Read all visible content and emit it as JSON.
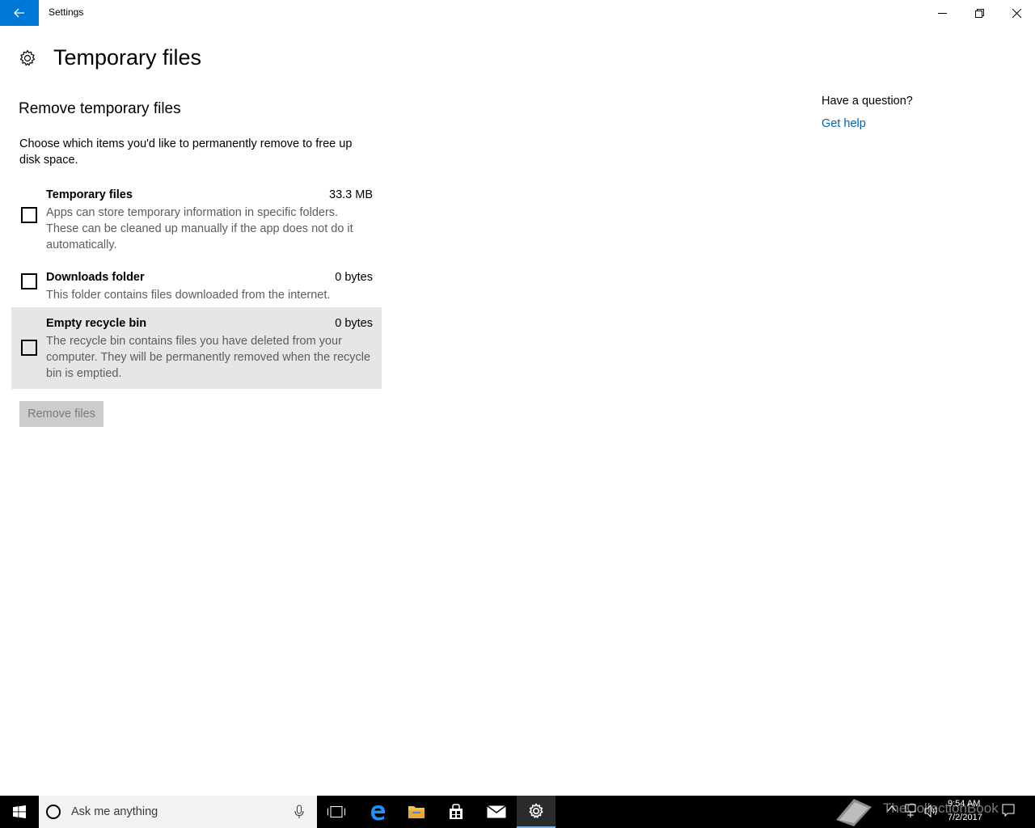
{
  "window": {
    "title": "Settings"
  },
  "page": {
    "title": "Temporary files"
  },
  "section": {
    "title": "Remove temporary files",
    "intro": "Choose which items you'd like to permanently remove to free up disk space."
  },
  "items": [
    {
      "name": "Temporary files",
      "size": "33.3 MB",
      "description": "Apps can store temporary information in specific folders. These can be cleaned up manually if the app does not do it automatically.",
      "checked": false
    },
    {
      "name": "Downloads folder",
      "size": "0 bytes",
      "description": "This folder contains files downloaded from the internet.",
      "checked": false
    },
    {
      "name": "Empty recycle bin",
      "size": "0 bytes",
      "description": "The recycle bin contains files you have deleted from your computer. They will be permanently removed when the recycle bin is emptied.",
      "checked": false
    }
  ],
  "actions": {
    "remove_label": "Remove files"
  },
  "help": {
    "question": "Have a question?",
    "link": "Get help"
  },
  "taskbar": {
    "search_placeholder": "Ask me anything",
    "time": "9:54 AM",
    "date": "7/2/2017",
    "watermark": "TheCollectionBook"
  },
  "colors": {
    "accent": "#0078d7",
    "link": "#0063b1",
    "hover_row": "#e6e6e6",
    "disabled_button": "#cccccc"
  },
  "icons": [
    "back-arrow-icon",
    "minimize-icon",
    "restore-icon",
    "close-icon",
    "gear-icon",
    "windows-logo-icon",
    "cortana-icon",
    "microphone-icon",
    "task-view-icon",
    "edge-icon",
    "file-explorer-icon",
    "store-icon",
    "mail-icon",
    "settings-icon",
    "chevron-up-icon",
    "network-icon",
    "volume-icon",
    "action-center-icon"
  ]
}
